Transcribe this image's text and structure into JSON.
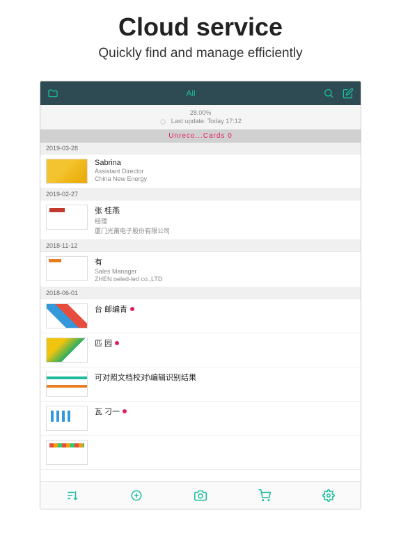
{
  "hero": {
    "title": "Cloud service",
    "subtitle": "Quickly find and manage efficiently"
  },
  "topbar": {
    "title": "All"
  },
  "status": {
    "percent": "28.00%",
    "last_update": "Last update:  Today  17:12"
  },
  "banner": {
    "text": "Unreco...Cards  0"
  },
  "groups": [
    {
      "date": "2019-03-28",
      "cards": [
        {
          "name": "Sabrina",
          "title": "Assistant Director",
          "company": "China New Energy",
          "thumb": "th-a",
          "flag": false
        }
      ]
    },
    {
      "date": "2019-02-27",
      "cards": [
        {
          "name": "张 桂燕",
          "title": "经理",
          "company": "厦门光莆电子股份有限公司",
          "thumb": "th-b",
          "flag": false
        }
      ]
    },
    {
      "date": "2018-11-12",
      "cards": [
        {
          "name": "有",
          "title": "Sales Manager",
          "company": "ZHEN oeled-led co.,LTD",
          "thumb": "th-c",
          "flag": false
        }
      ]
    },
    {
      "date": "2018-06-01",
      "cards": [
        {
          "name": "台 邮编青",
          "title": "",
          "company": "",
          "thumb": "th-d",
          "flag": true
        },
        {
          "name": "匹 园",
          "title": "",
          "company": "",
          "thumb": "th-e",
          "flag": true
        },
        {
          "name": "可对照文档校对\\编辑识别结果",
          "title": "",
          "company": "",
          "thumb": "th-f",
          "flag": false
        },
        {
          "name": "瓦 刁一",
          "title": "",
          "company": "",
          "thumb": "th-g",
          "flag": true
        },
        {
          "name": "",
          "title": "",
          "company": "",
          "thumb": "th-h",
          "flag": false
        }
      ]
    }
  ]
}
